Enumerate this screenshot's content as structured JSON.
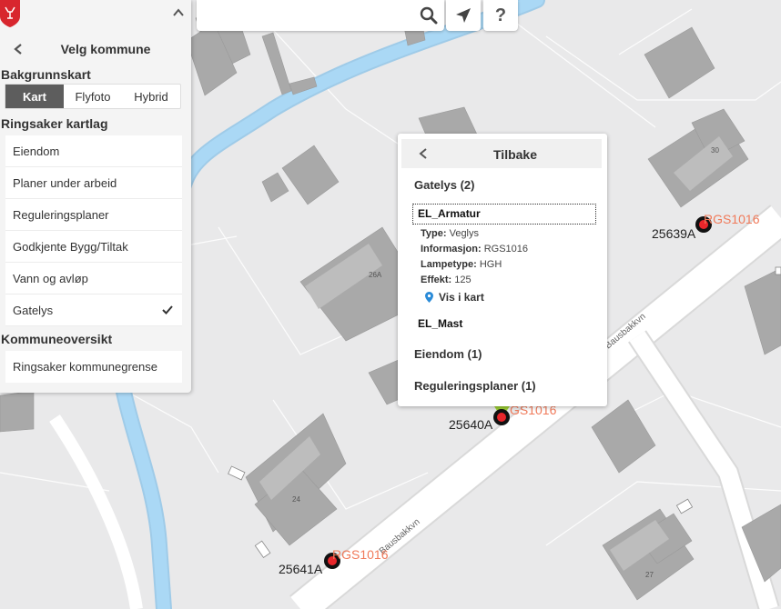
{
  "search": {
    "value": "",
    "placeholder": ""
  },
  "icons": {
    "search": "search-icon",
    "locate": "location-arrow-icon",
    "help": "question-mark"
  },
  "help_label": "?",
  "left_panel": {
    "municipality_title": "Velg kommune",
    "background_heading": "Bakgrunnskart",
    "background_options": [
      {
        "label": "Kart",
        "active": true
      },
      {
        "label": "Flyfoto",
        "active": false
      },
      {
        "label": "Hybrid",
        "active": false
      }
    ],
    "layers_heading": "Ringsaker kartlag",
    "layers": [
      {
        "label": "Eiendom",
        "checked": false
      },
      {
        "label": "Planer under arbeid",
        "checked": false
      },
      {
        "label": "Reguleringsplaner",
        "checked": false
      },
      {
        "label": "Godkjente Bygg/Tiltak",
        "checked": false
      },
      {
        "label": "Vann og avløp",
        "checked": false
      },
      {
        "label": "Gatelys",
        "checked": true
      }
    ],
    "overview_heading": "Kommuneoversikt",
    "overview_items": [
      "Ringsaker kommunegrense"
    ]
  },
  "popup": {
    "title": "Tilbake",
    "group1": "Gatelys (2)",
    "selected": "EL_Armatur",
    "attributes": [
      {
        "key": "Type:",
        "value": "Veglys"
      },
      {
        "key": "Informasjon:",
        "value": "RGS1016"
      },
      {
        "key": "Lampetype:",
        "value": "HGH"
      },
      {
        "key": "Effekt:",
        "value": "125"
      }
    ],
    "show_in_map": "Vis i kart",
    "item2": "EL_Mast",
    "group2": "Eiendom (1)",
    "group3": "Reguleringsplaner (1)"
  },
  "map": {
    "lights": [
      {
        "id": "25639A",
        "code": "RGS1016"
      },
      {
        "id": "25640A",
        "code": "RGS1016"
      },
      {
        "id": "25641A",
        "code": "RGS1016"
      }
    ],
    "road_name": "Bausbakkvn",
    "house_numbers": [
      "30",
      "26A",
      "24",
      "27",
      "2"
    ],
    "colors": {
      "background": "#e9e9ea",
      "building": "#a9a9a9",
      "river": "#a9d5f2",
      "road": "#ffffff",
      "light_marker": "#e8262b",
      "label_accent": "#f07a5a"
    }
  }
}
